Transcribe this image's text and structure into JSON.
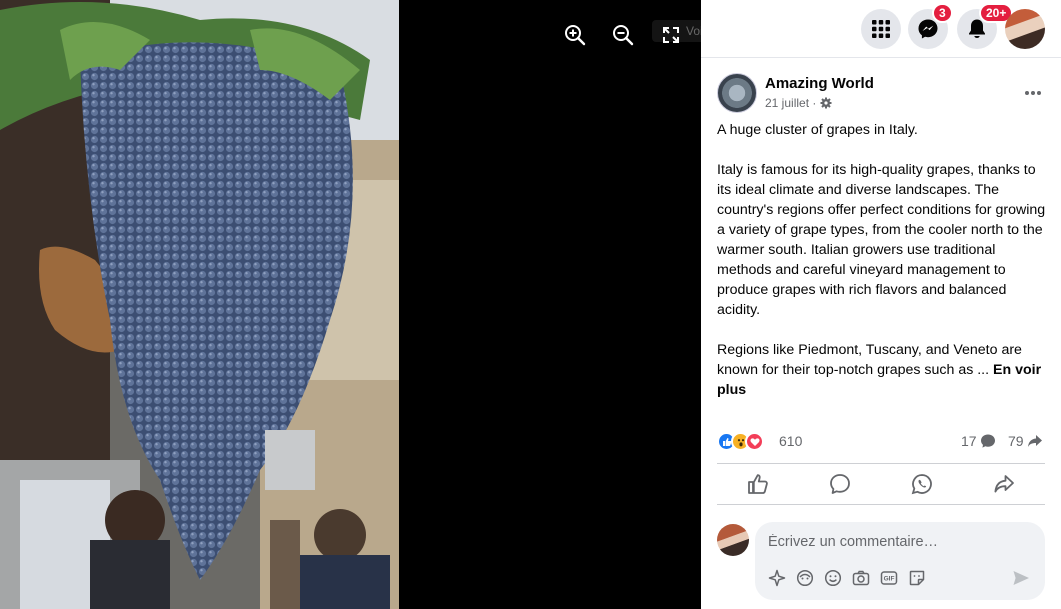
{
  "viewer": {
    "zoom_in_icon": "zoom-in-icon",
    "zoom_out_icon": "zoom-out-icon",
    "fullscreen_icon": "fullscreen-icon",
    "ghost_label": "Voir plus actus"
  },
  "topbar": {
    "menu_icon": "grid-menu-icon",
    "messenger_badge": "3",
    "notifications_badge": "20+"
  },
  "post": {
    "page_name": "Amazing World",
    "date": "21 juillet ·",
    "paragraph1": "A huge cluster of grapes in Italy.",
    "paragraph2": "Italy is famous for its high-quality grapes, thanks to its ideal climate and diverse landscapes. The country's regions offer perfect conditions for growing a variety of grape types, from the cooler north to the warmer south. Italian growers use traditional methods and careful vineyard management to produce grapes with rich flavors and balanced acidity.",
    "paragraph3": "Regions like Piedmont, Tuscany, and Veneto are known for their top-notch grapes such as ...",
    "see_more": "En voir plus"
  },
  "stats": {
    "reactions": "610",
    "comments": "17",
    "shares": "79"
  },
  "comment": {
    "placeholder": "Écrivez un commentaire…"
  },
  "colors": {
    "like_blue": "#1877f2",
    "love_red": "#f33e58",
    "badge_red": "#e41e3f"
  }
}
